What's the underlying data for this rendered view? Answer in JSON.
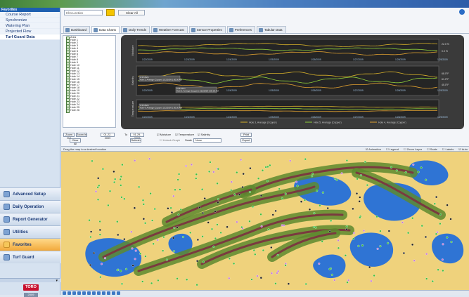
{
  "sidebar": {
    "favorites_header": "Favorites",
    "favorites": [
      "Course Report",
      "Synchronize",
      "Watering Plan",
      "Projected Flow",
      "Turf Guard Data"
    ],
    "nav": [
      "Advanced Setup",
      "Daily Operation",
      "Report Generator",
      "Utilities",
      "Favorites",
      "Turf Guard"
    ],
    "brand": "TORO",
    "version": "2009"
  },
  "toolbar": {
    "course_select": "Hlm.Leetion",
    "clear_all": "Clear All"
  },
  "tabs": [
    "Dashboard",
    "Data Charts",
    "Daily Trends",
    "Weather Forecast",
    "Sensor Properties",
    "Preferences",
    "Tabular Data"
  ],
  "tree": [
    "Area",
    "Hole 1",
    "Hole 2",
    "Hole 3",
    "Hole 4",
    "Hole 5",
    "Hole 6",
    "Hole 7",
    "Hole 8",
    "Hole 9",
    "Hole 10",
    "Hole 11",
    "Hole 12",
    "Hole 13",
    "Hole 14",
    "Hole 15",
    "Hole 16",
    "Hole 17",
    "Hole 18",
    "Hole 19",
    "Hole 20",
    "Hole 21",
    "Hole 22",
    "Hole 23",
    "Hole 24",
    "Hole 25",
    "Hole 26"
  ],
  "chart": {
    "panels": [
      "Moisture",
      "Salinity",
      "Temperature"
    ],
    "x_ticks": [
      "1/22/2009",
      "1/23/2009",
      "1/24/2009",
      "1/25/2009",
      "1/26/2009",
      "1/27/2009",
      "1/28/2009",
      "1/29/2009"
    ],
    "right_labels": [
      "22.0 %",
      "0.0 %",
      "68.0°F",
      "61.0°F",
      "45.0°F"
    ],
    "tooltips": [
      "0.35 dS/m / Hole 3, Average (Copper) 1/22/2009 1:00:00 AM",
      "0.68 dS/m / Hole 5, Average (Copper) 1/22/2009 3:00:00 AM",
      "0.35 dS/m / Hole 4, Average (Copper) 1/22/2009 1:00:00 AM"
    ],
    "legend": [
      "Hole 3, Average (Copper)",
      "Hole 5, Average (Copper)",
      "Hole 4, Average (Copper)"
    ],
    "colors": {
      "series1": "#d6b02a",
      "series2": "#8fcf3a",
      "series3": "#e0a030",
      "panel_bg": "#2c2c2c"
    }
  },
  "controls": {
    "zoom_out": "Zoom Out",
    "zoom_in": "Zoom In",
    "clear_all": "Clear All",
    "start_date": "01-22-2009",
    "to_label": "To",
    "end_date": "01-29-2009",
    "refresh": "Refresh",
    "checks": [
      "Moisture",
      "Temperature",
      "Salinity"
    ],
    "unlock_graph": "Unlock Graph",
    "scale_label": "Scale",
    "scale_value": "None",
    "print": "Print",
    "export": "Export"
  },
  "map": {
    "hint": "Drag the map to a desired location",
    "options": [
      "Animation",
      "Legend",
      "Zoom Layer",
      "Scale",
      "Labels",
      "Auto"
    ]
  }
}
